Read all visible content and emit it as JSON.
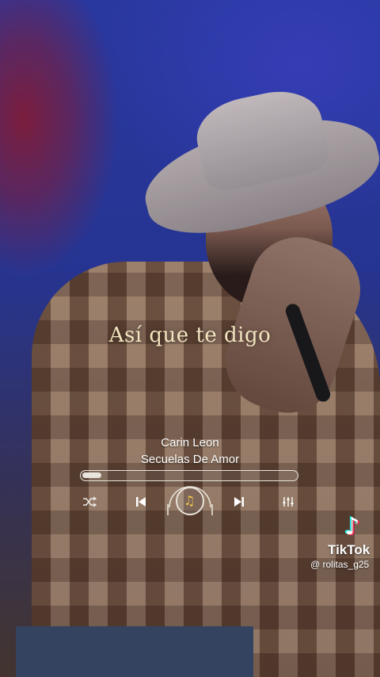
{
  "lyric": {
    "text": "Así que te digo"
  },
  "player": {
    "artist": "Carin Leon",
    "song": "Secuelas De Amor",
    "progress": 0.09,
    "controls": {
      "shuffle_icon": "shuffle-icon",
      "prev_icon": "skip-previous-icon",
      "play_icon": "music-note-disc-icon",
      "next_icon": "skip-next-icon",
      "equalizer_icon": "equalizer-icon"
    }
  },
  "watermark": {
    "brand": "TikTok",
    "handle": "@ rolitas_g25"
  },
  "colors": {
    "lyric": "#f1e4bf",
    "text": "#ffffff",
    "accent_note": "#f3c648",
    "tiktok_cyan": "#25f4ee",
    "tiktok_red": "#fe2c55"
  }
}
